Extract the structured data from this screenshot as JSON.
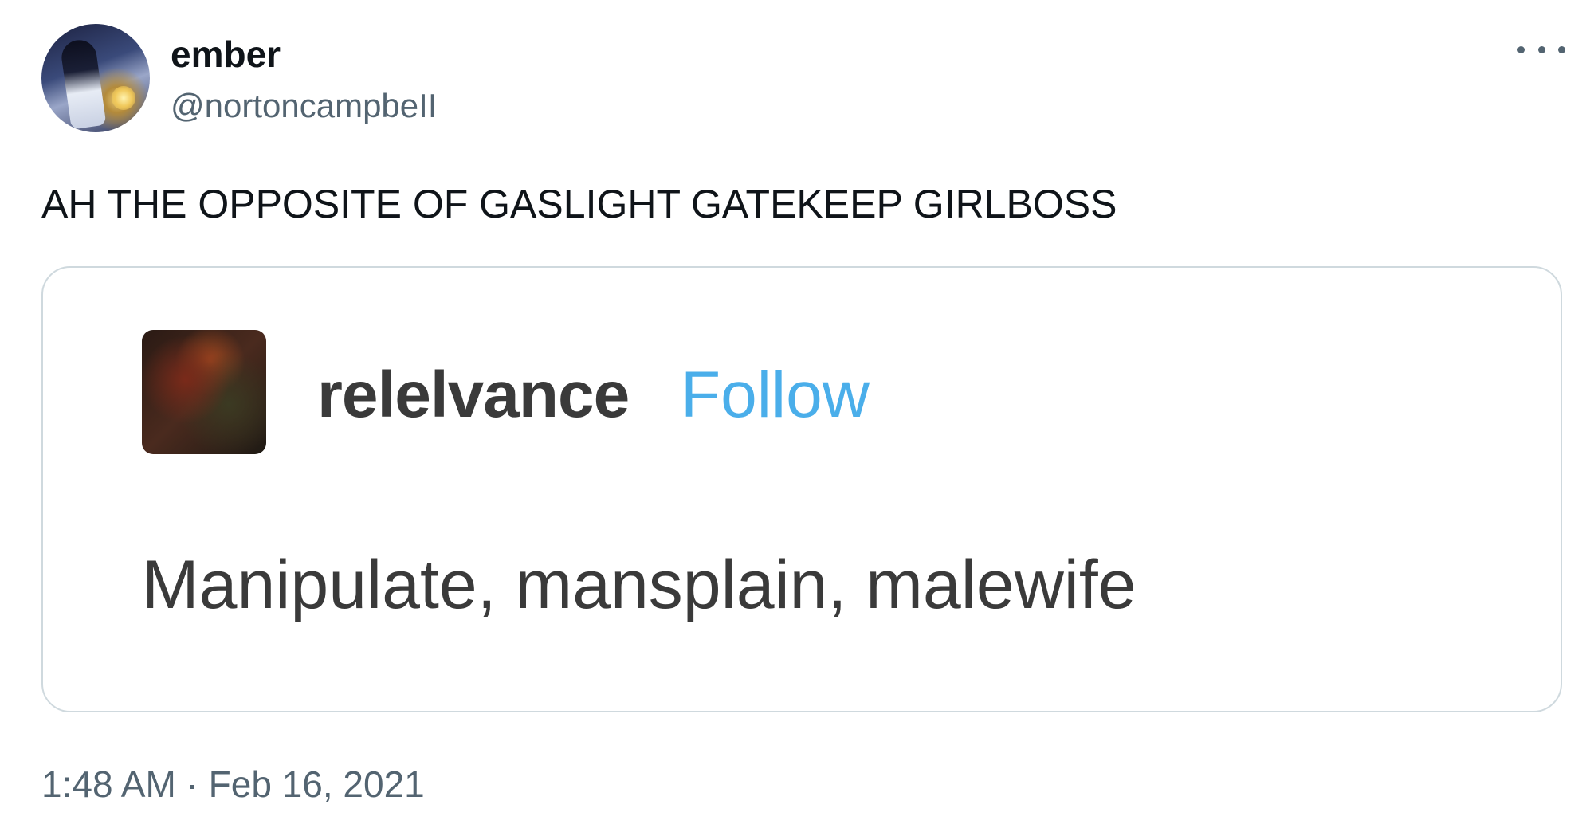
{
  "author": {
    "display_name": "ember",
    "handle": "@nortoncampbeII"
  },
  "tweet": {
    "text": "AH THE OPPOSITE OF GASLIGHT GATEKEEP GIRLBOSS",
    "timestamp": "1:48 AM · Feb 16, 2021"
  },
  "embed": {
    "username": "relelvance",
    "follow_label": "Follow",
    "text": "Manipulate, mansplain, malewife"
  },
  "icons": {
    "more": "more-horizontal-icon",
    "author_avatar": "avatar",
    "embed_avatar": "avatar"
  },
  "colors": {
    "primary_text": "#0f1419",
    "secondary_text": "#536471",
    "border": "#cfd9de",
    "follow_blue": "#4aaeea",
    "embed_text": "#3a3a3a"
  }
}
